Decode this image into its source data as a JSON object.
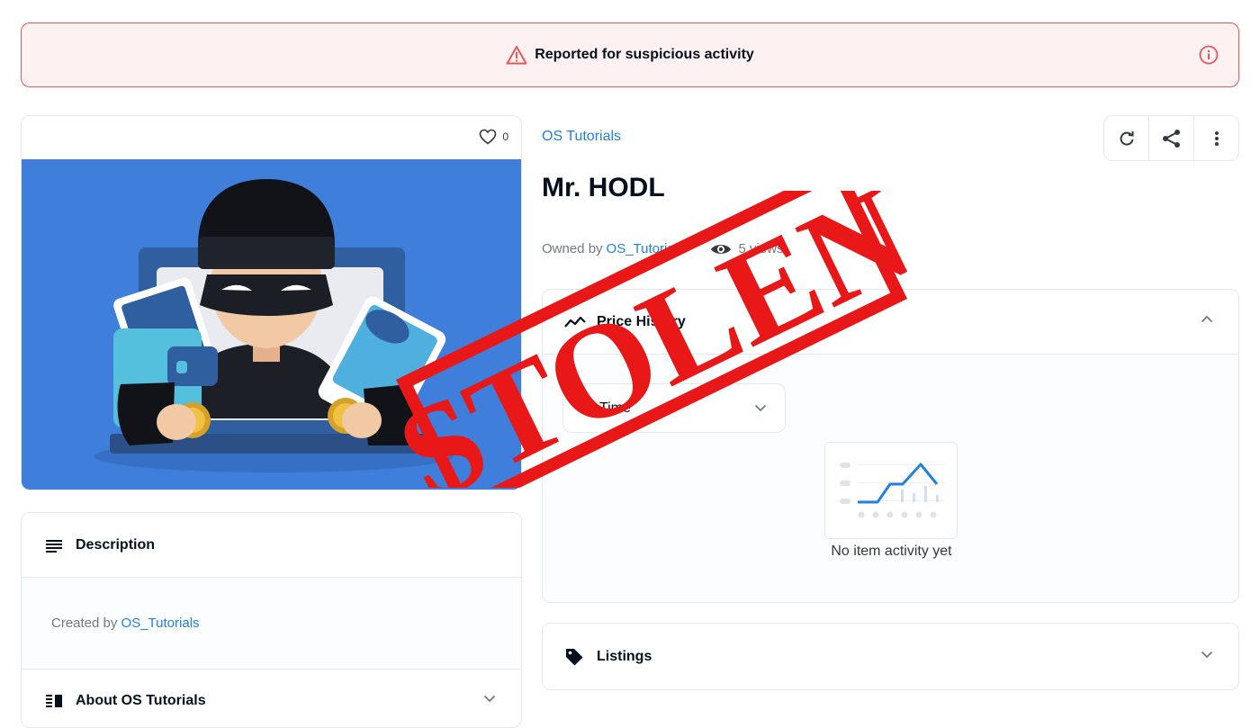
{
  "banner": {
    "text": "Reported for suspicious activity"
  },
  "item": {
    "favorites": "0",
    "collection": "OS Tutorials",
    "title": "Mr. HODL",
    "owned_by_label": "Owned by",
    "owner": "OS_Tutorials",
    "views": "5 views"
  },
  "description": {
    "heading": "Description",
    "created_by_label": "Created by",
    "creator": "OS_Tutorials"
  },
  "about": {
    "heading": "About OS Tutorials"
  },
  "price_history": {
    "heading": "Price History",
    "range_selected": "All Time",
    "empty_text": "No item activity yet"
  },
  "listings": {
    "heading": "Listings"
  },
  "stamp": {
    "text": "STOLEN"
  },
  "icons": {
    "banner_warning": "warning-triangle-icon",
    "banner_info": "info-icon",
    "heart": "heart-icon",
    "refresh": "refresh-icon",
    "share": "share-icon",
    "more": "more-vertical-icon",
    "eye": "eye-icon",
    "chart": "chart-line-icon",
    "description": "list-lines-icon",
    "about": "about-icon",
    "tag": "tag-icon"
  },
  "colors": {
    "accent": "#2081e2",
    "danger": "#eb5757",
    "stamp": "#e81818",
    "art_background": "#3f7fdb"
  }
}
